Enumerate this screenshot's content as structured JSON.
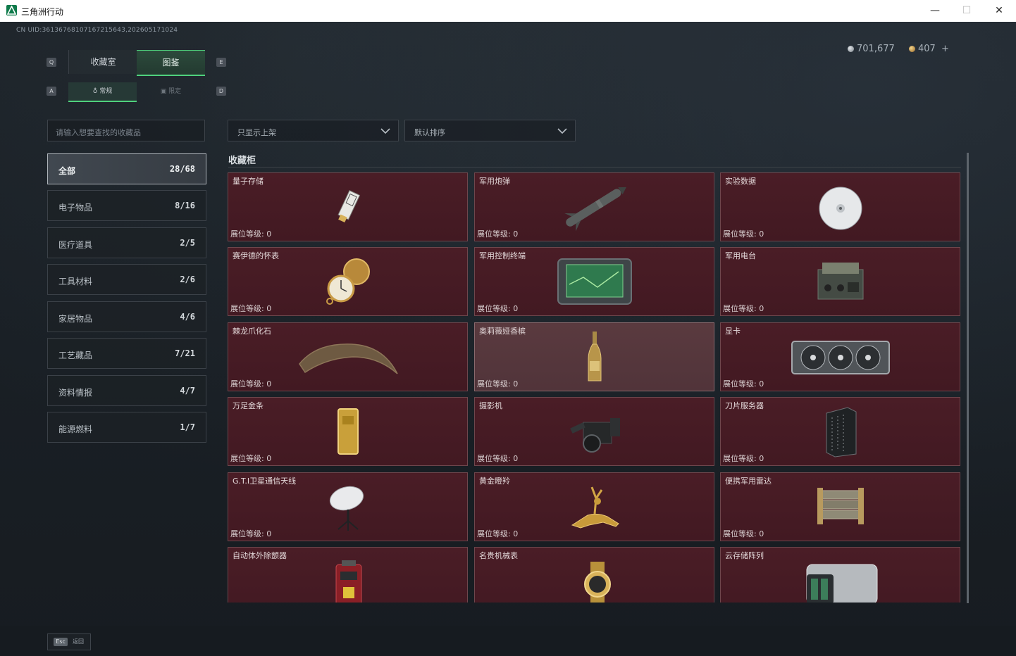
{
  "window": {
    "title": "三角洲行动",
    "minimize": "—",
    "maximize": "☐",
    "close": "✕"
  },
  "uid": "CN UID:36136768107167215643,202605171024",
  "currency": {
    "silver": "701,677",
    "gold": "407",
    "add": "+"
  },
  "hotkeys": {
    "prev_main": "Q",
    "next_main": "E",
    "prev_sub": "A",
    "next_sub": "D"
  },
  "main_tabs": [
    {
      "label": "收藏室",
      "active": false
    },
    {
      "label": "图鉴",
      "active": true
    }
  ],
  "sub_tabs": [
    {
      "label": "常规",
      "active": true
    },
    {
      "label": "限定",
      "active": false
    }
  ],
  "search": {
    "placeholder": "请输入想要查找的收藏品"
  },
  "filters": {
    "shelf": "只显示上架",
    "sort": "默认排序"
  },
  "categories": [
    {
      "name": "全部",
      "count": "28/68",
      "selected": true
    },
    {
      "name": "电子物品",
      "count": "8/16"
    },
    {
      "name": "医疗道具",
      "count": "2/5"
    },
    {
      "name": "工具材料",
      "count": "2/6"
    },
    {
      "name": "家居物品",
      "count": "4/6"
    },
    {
      "name": "工艺藏品",
      "count": "7/21"
    },
    {
      "name": "资料情报",
      "count": "4/7"
    },
    {
      "name": "能源燃料",
      "count": "1/7"
    }
  ],
  "section_title": "收藏柜",
  "level_label": "展位等级: 0",
  "items": [
    {
      "name": "量子存储",
      "icon": "usb-drive-icon"
    },
    {
      "name": "军用炮弹",
      "icon": "missile-icon"
    },
    {
      "name": "实验数据",
      "icon": "disc-icon"
    },
    {
      "name": "赛伊德的怀表",
      "icon": "pocket-watch-icon"
    },
    {
      "name": "军用控制终端",
      "icon": "tablet-terminal-icon"
    },
    {
      "name": "军用电台",
      "icon": "radio-icon"
    },
    {
      "name": "棘龙爪化石",
      "icon": "claw-fossil-icon"
    },
    {
      "name": "奥莉薇娅香槟",
      "icon": "champagne-bottle-icon"
    },
    {
      "name": "显卡",
      "icon": "graphics-card-icon"
    },
    {
      "name": "万足金条",
      "icon": "gold-bar-icon"
    },
    {
      "name": "摄影机",
      "icon": "camera-icon"
    },
    {
      "name": "刀片服务器",
      "icon": "server-icon"
    },
    {
      "name": "G.T.I卫星通信天线",
      "icon": "satellite-dish-icon"
    },
    {
      "name": "黄金瞪羚",
      "icon": "gold-gazelle-icon"
    },
    {
      "name": "便携军用雷达",
      "icon": "radar-icon"
    },
    {
      "name": "自动体外除颤器",
      "icon": "defibrillator-icon"
    },
    {
      "name": "名贵机械表",
      "icon": "wristwatch-icon"
    },
    {
      "name": "云存储阵列",
      "icon": "storage-array-icon"
    }
  ],
  "footer": {
    "esc_key": "Esc",
    "back_label": "返回"
  }
}
